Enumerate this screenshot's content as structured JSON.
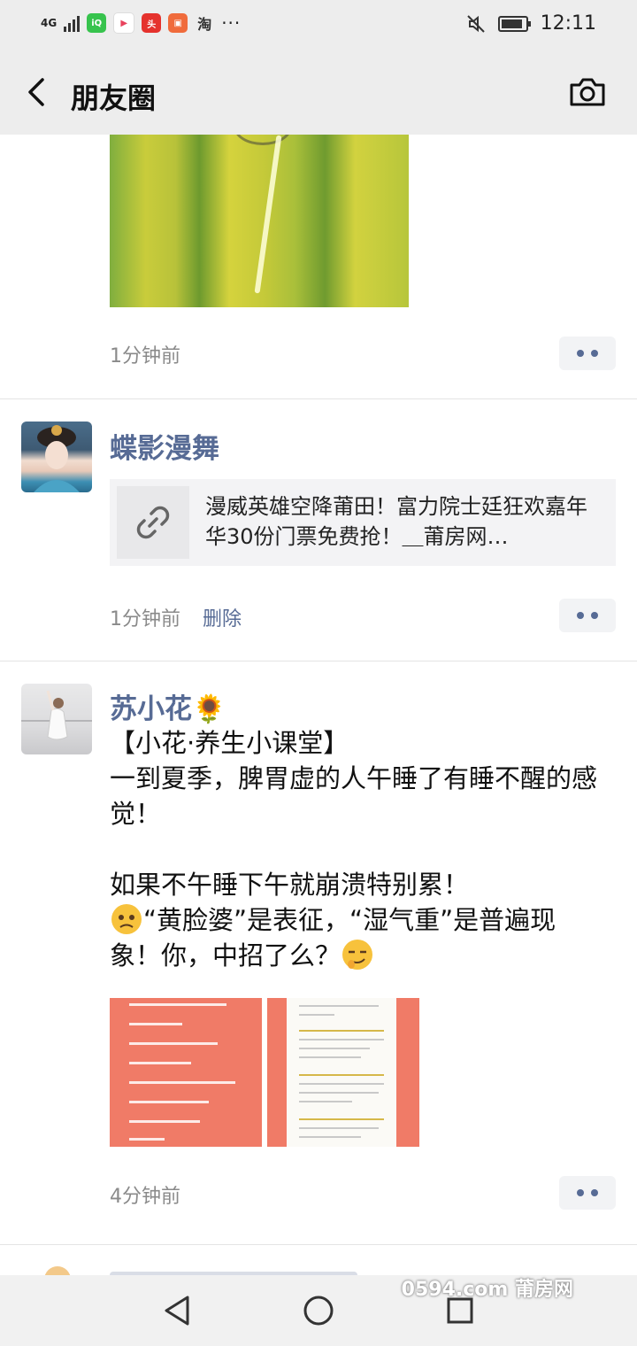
{
  "status_bar": {
    "network": "4G",
    "apps": [
      "iqiyi",
      "bilibili",
      "toutiao",
      "jingdong",
      "taobao"
    ],
    "dots": "···",
    "time": "12:11",
    "battery_level": 0.9
  },
  "navbar": {
    "title": "朋友圈",
    "back_icon": "chevron-left-icon",
    "camera_icon": "camera-icon"
  },
  "posts": [
    {
      "time": "1分钟前",
      "has_photo": true
    },
    {
      "author": "蝶影漫舞",
      "link_title": "漫威英雄空降莆田！富力院士廷狂欢嘉年华30份门票免费抢！＿莆房网…",
      "time": "1分钟前",
      "delete_label": "删除"
    },
    {
      "author": "苏小花🌻",
      "text_line1": "【小花·养生小课堂】",
      "text_line2": "一到夏季，脾胃虚的人午睡了有睡不醒的感觉！",
      "text_line3": "如果不午睡下午就崩溃特别累！",
      "text_line4": "“黄脸婆”是表征，“湿气重”是普遍现象！你，中招了么？",
      "time": "4分钟前"
    }
  ],
  "watermark": "0594.com 莆房网",
  "colors": {
    "name_blue": "#576b95",
    "time_gray": "#8a8a8a",
    "bar_gray": "#ededed",
    "doc_salmon": "#f07b67"
  }
}
